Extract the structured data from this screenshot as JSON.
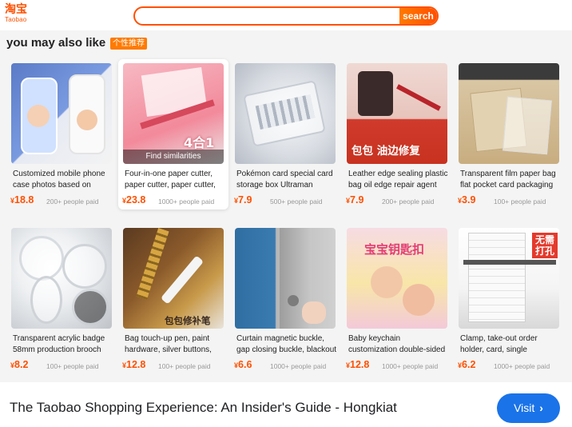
{
  "logo": {
    "cn": "淘宝",
    "en": "Taobao"
  },
  "search": {
    "placeholder": "",
    "button": "search"
  },
  "section": {
    "title": "you may also like",
    "badge": "个性推荐"
  },
  "hover_label": "Find similarities",
  "products": [
    {
      "name": "Customized mobile phone case photos based on",
      "currency": "¥",
      "price": "18.8",
      "sold": "200+ people paid",
      "overlay": "",
      "icon": "phone-case"
    },
    {
      "name": "Four-in-one paper cutter, paper cutter, paper cutter,",
      "currency": "¥",
      "price": "23.8",
      "sold": "1000+ people paid",
      "overlay": "4合1",
      "icon": "paper-cutter"
    },
    {
      "name": "Pokémon card special card storage box Ultraman",
      "currency": "¥",
      "price": "7.9",
      "sold": "500+ people paid",
      "overlay": "",
      "icon": "card-box"
    },
    {
      "name": "Leather edge sealing plastic bag oil edge repair agent",
      "currency": "¥",
      "price": "7.9",
      "sold": "200+ people paid",
      "overlay": "包包 油边修复",
      "icon": "edge-paint"
    },
    {
      "name": "Transparent film paper bag flat pocket card packaging",
      "currency": "¥",
      "price": "3.9",
      "sold": "100+ people paid",
      "overlay": "",
      "icon": "paper-bag"
    },
    {
      "name": "Transparent acrylic badge 58mm production brooch",
      "currency": "¥",
      "price": "8.2",
      "sold": "100+ people paid",
      "overlay": "",
      "icon": "acrylic-badge"
    },
    {
      "name": "Bag touch-up pen, paint hardware, silver buttons,",
      "currency": "¥",
      "price": "12.8",
      "sold": "100+ people paid",
      "overlay": "包包修补笔",
      "icon": "touch-up-pen"
    },
    {
      "name": "Curtain magnetic buckle, gap closing buckle, blackout",
      "currency": "¥",
      "price": "6.6",
      "sold": "1000+ people paid",
      "overlay": "",
      "icon": "magnetic-buckle"
    },
    {
      "name": "Baby keychain customization double-sided photo acrylic",
      "currency": "¥",
      "price": "12.8",
      "sold": "1000+ people paid",
      "overlay": "宝宝钥匙扣",
      "icon": "keychain"
    },
    {
      "name": "Clamp, take-out order holder, card, single pressure,",
      "currency": "¥",
      "price": "6.2",
      "sold": "1000+ people paid",
      "overlay": "无需打孔",
      "icon": "order-clamp"
    }
  ],
  "footer": {
    "title": "The Taobao Shopping Experience: An Insider's Guide - Hongkiat",
    "visit": "Visit"
  },
  "colors": {
    "brand": "#ff5000",
    "link_button": "#1a73e8"
  }
}
